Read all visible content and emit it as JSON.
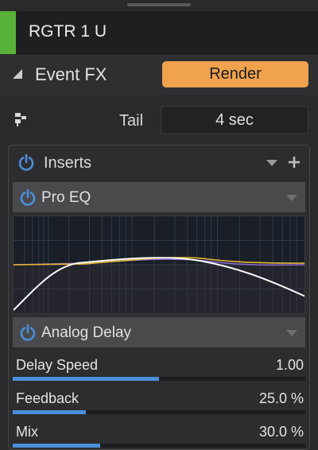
{
  "track": {
    "name": "RGTR 1 U",
    "color": "#58b23a"
  },
  "event_fx": {
    "label": "Event FX",
    "render_label": "Render",
    "accent": "#f0a24c"
  },
  "tail": {
    "label": "Tail",
    "value": "4 sec"
  },
  "inserts": {
    "label": "Inserts",
    "plugins": [
      {
        "name": "Pro EQ",
        "enabled": true
      },
      {
        "name": "Analog Delay",
        "enabled": true
      }
    ]
  },
  "params": [
    {
      "name": "Delay Speed",
      "value": "1.00",
      "level": 0.5
    },
    {
      "name": "Feedback",
      "value": "25.0 %",
      "level": 0.25
    },
    {
      "name": "Mix",
      "value": "30.0 %",
      "level": 0.3
    }
  ],
  "icons": {
    "power": "power-icon",
    "plus": "plus-icon",
    "dropdown": "chevron-down-icon",
    "tail": "tail-icon",
    "collapse": "triangle-icon"
  },
  "colors": {
    "power": "#4a8fdb",
    "eq_curve": "#ffffff",
    "eq_band_gold": "#e8b830",
    "eq_band_purple": "#8b6bd0"
  }
}
